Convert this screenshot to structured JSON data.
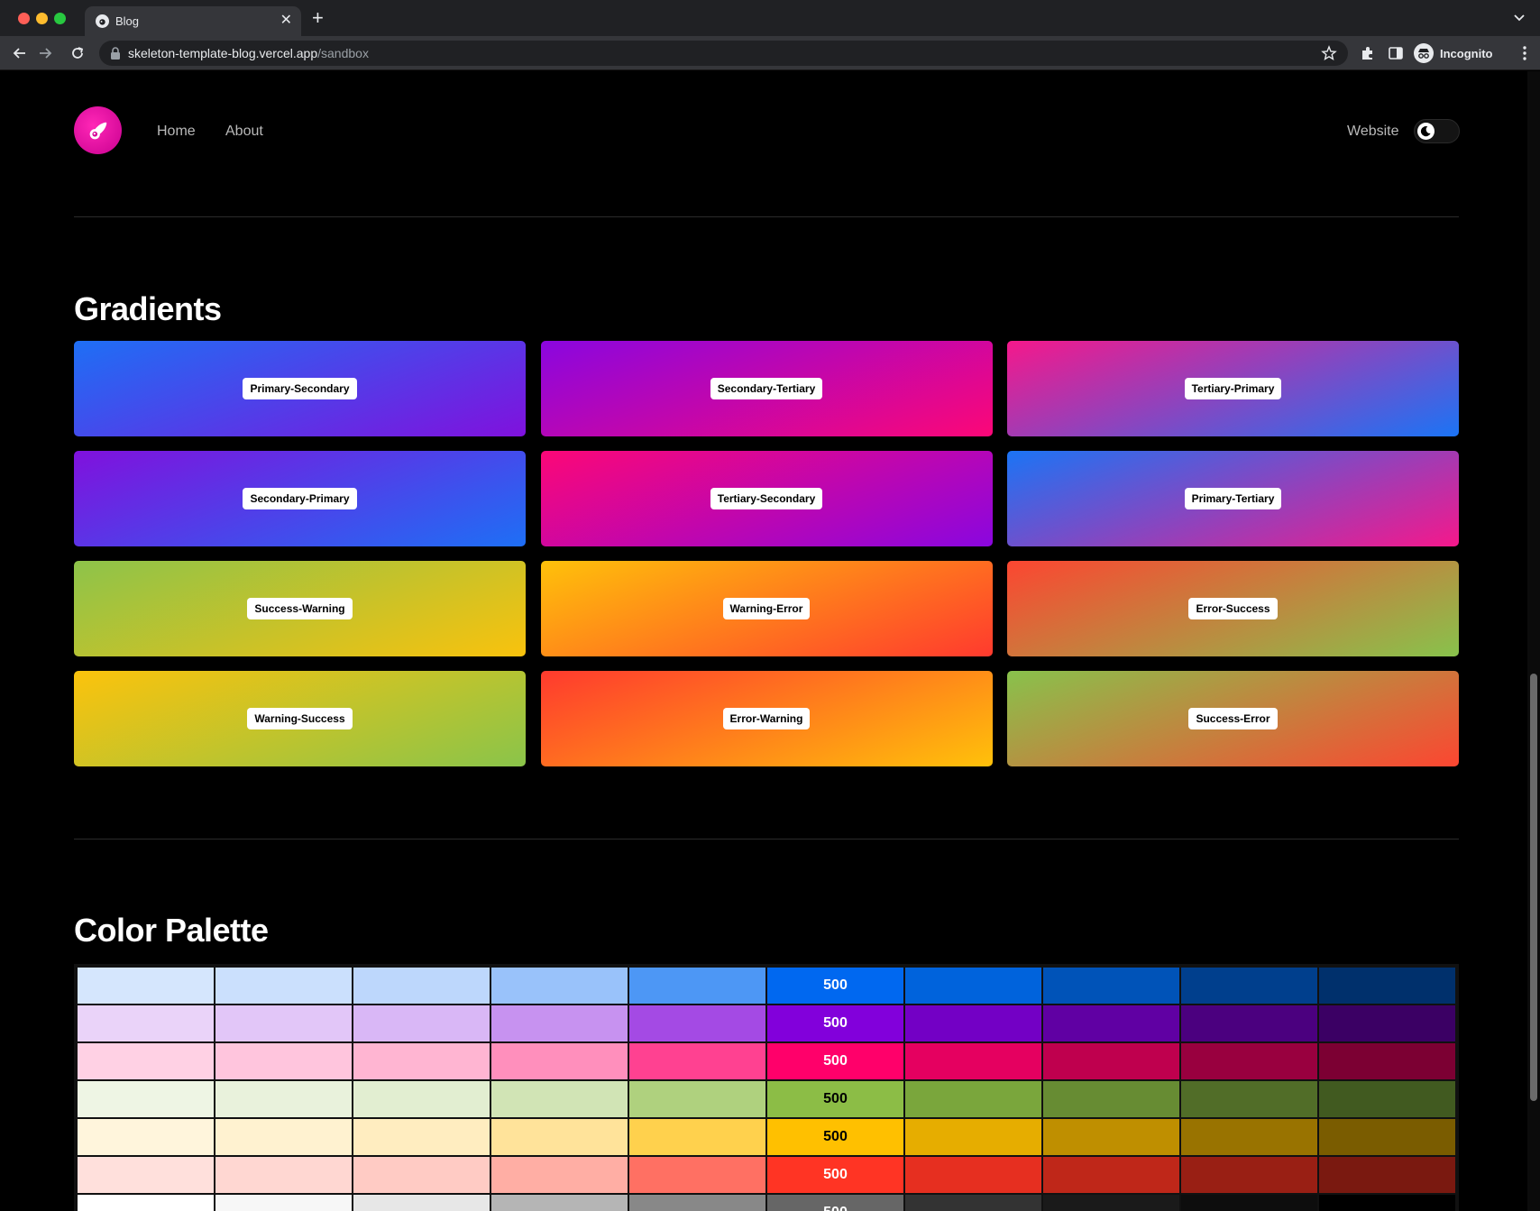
{
  "browser": {
    "tab_title": "Blog",
    "url_host": "skeleton-template-blog.vercel.app",
    "url_path": "/sandbox",
    "profile_label": "Incognito"
  },
  "header": {
    "nav": [
      "Home",
      "About"
    ],
    "website_label": "Website"
  },
  "gradients": {
    "title": "Gradients",
    "items": [
      {
        "label": "Primary-Secondary",
        "from": "#1e6ff5",
        "to": "#8011dd"
      },
      {
        "label": "Secondary-Tertiary",
        "from": "#8a06df",
        "to": "#fc0777"
      },
      {
        "label": "Tertiary-Primary",
        "from": "#f5188b",
        "to": "#1b74f5"
      },
      {
        "label": "Secondary-Primary",
        "from": "#8011dd",
        "to": "#1e6ff5"
      },
      {
        "label": "Tertiary-Secondary",
        "from": "#fc0777",
        "to": "#8a06df"
      },
      {
        "label": "Primary-Tertiary",
        "from": "#1b74f5",
        "to": "#f5188b"
      },
      {
        "label": "Success-Warning",
        "from": "#8dc34a",
        "to": "#f9c20d"
      },
      {
        "label": "Warning-Error",
        "from": "#ffc10a",
        "to": "#ff3a2e"
      },
      {
        "label": "Error-Success",
        "from": "#fc4631",
        "to": "#88c24c"
      },
      {
        "label": "Warning-Success",
        "from": "#fcc30c",
        "to": "#8ac44a"
      },
      {
        "label": "Error-Warning",
        "from": "#ff3a2e",
        "to": "#ffc10a"
      },
      {
        "label": "Success-Error",
        "from": "#88c24c",
        "to": "#fc4631"
      }
    ]
  },
  "palette": {
    "title": "Color Palette",
    "label_500": "500",
    "rows": [
      [
        "#d5e6fd",
        "#cbe0fd",
        "#bdd7fc",
        "#99c2fa",
        "#4d97f5",
        "#0068f0",
        "#0063dc",
        "#0053b8",
        "#003f8d",
        "#00306c"
      ],
      [
        "#ead3f9",
        "#e2c6f8",
        "#d9b7f6",
        "#c792f0",
        "#a44ae4",
        "#8200db",
        "#7300c5",
        "#6000a3",
        "#4b007f",
        "#3b0064"
      ],
      [
        "#ffd1e4",
        "#ffc5dd",
        "#ffb5d2",
        "#ff8fbc",
        "#ff4191",
        "#ff006a",
        "#e50060",
        "#bf004e",
        "#99003f",
        "#7c0033"
      ],
      [
        "#eef5e4",
        "#e9f2dc",
        "#e2eed1",
        "#d1e4b5",
        "#afd17e",
        "#8cbd46",
        "#7aa63c",
        "#678c33",
        "#516d28",
        "#415a20"
      ],
      [
        "#fff5dc",
        "#fff2d0",
        "#ffedc0",
        "#ffe39a",
        "#ffd14d",
        "#ffc000",
        "#e6ad00",
        "#bf8f00",
        "#997300",
        "#7a5c00"
      ],
      [
        "#ffe0dc",
        "#ffd7d2",
        "#ffcbc4",
        "#ffaea4",
        "#ff7063",
        "#ff3424",
        "#e62f20",
        "#bf2719",
        "#991f14",
        "#7a1910"
      ],
      [
        "#ffffff",
        "#f7f7f7",
        "#e7e7e7",
        "#b5b5b5",
        "#888888",
        "#666666",
        "#333333",
        "#1a1a1a",
        "#0d0d0d",
        "#000000"
      ]
    ]
  }
}
